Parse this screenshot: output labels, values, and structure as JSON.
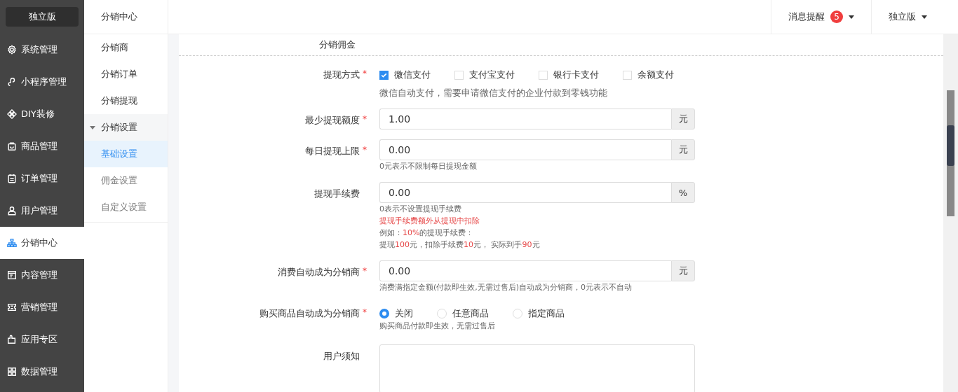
{
  "sidebar": {
    "brand": "独立版",
    "items": [
      {
        "label": "系统管理",
        "selected": false
      },
      {
        "label": "小程序管理",
        "selected": false
      },
      {
        "label": "DIY装修",
        "selected": false
      },
      {
        "label": "商品管理",
        "selected": false
      },
      {
        "label": "订单管理",
        "selected": false
      },
      {
        "label": "用户管理",
        "selected": false
      },
      {
        "label": "分销中心",
        "selected": true
      },
      {
        "label": "内容管理",
        "selected": false
      },
      {
        "label": "营销管理",
        "selected": false
      },
      {
        "label": "应用专区",
        "selected": false
      },
      {
        "label": "数据管理",
        "selected": false
      }
    ]
  },
  "subnav": {
    "title": "分销中心",
    "items": [
      {
        "label": "分销商",
        "selected": false
      },
      {
        "label": "分销订单",
        "selected": false
      },
      {
        "label": "分销提现",
        "selected": false
      },
      {
        "label": "分销设置",
        "selected": false,
        "expanded": true,
        "children": [
          {
            "label": "基础设置",
            "selected": true
          },
          {
            "label": "佣金设置",
            "selected": false
          },
          {
            "label": "自定义设置",
            "selected": false
          }
        ]
      }
    ]
  },
  "topbar": {
    "notice": "消息提醒",
    "notice_count": "5",
    "edition": "独立版"
  },
  "form": {
    "section": "分销佣金",
    "fields": [
      {
        "kind": "checkboxes",
        "label": "提现方式",
        "required_mark": "*",
        "options": [
          {
            "label": "微信支付",
            "checked": true
          },
          {
            "label": "支付宝支付",
            "checked": false
          },
          {
            "label": "银行卡支付",
            "checked": false
          },
          {
            "label": "余额支付",
            "checked": false
          }
        ],
        "notes": [
          [
            {
              "text": "微信自动支付，需要申请微信支付的企业付款到零钱功能",
              "highlight": false
            }
          ]
        ]
      },
      {
        "kind": "input",
        "label": "最少提现额度",
        "required_mark": "*",
        "value": "1.00",
        "unit": "元"
      },
      {
        "kind": "input",
        "label": "每日提现上限",
        "required_mark": "*",
        "value": "0.00",
        "unit": "元",
        "notes": [
          [
            {
              "text": "0元表示不限制每日提现金额",
              "highlight": false
            }
          ]
        ]
      },
      {
        "kind": "input",
        "label": "提现手续费",
        "value": "0.00",
        "unit": "%",
        "notes": [
          [
            {
              "text": "0表示不设置提现手续费",
              "highlight": false
            }
          ],
          [
            {
              "text": "提现手续费额外从提现中扣除",
              "highlight": true
            }
          ],
          [
            {
              "text": "例如：",
              "highlight": false
            },
            {
              "text": "10%",
              "highlight": true
            },
            {
              "text": "的提现手续费：",
              "highlight": false
            }
          ],
          [
            {
              "text": "提现",
              "highlight": false
            },
            {
              "text": "100",
              "highlight": true
            },
            {
              "text": "元，扣除手续费",
              "highlight": false
            },
            {
              "text": "10",
              "highlight": true
            },
            {
              "text": "元， 实际到手",
              "highlight": false
            },
            {
              "text": "90",
              "highlight": true
            },
            {
              "text": "元",
              "highlight": false
            }
          ]
        ]
      },
      {
        "kind": "input",
        "label": "消费自动成为分销商",
        "required_mark": "*",
        "value": "0.00",
        "unit": "元",
        "notes": [
          [
            {
              "text": "消费满指定金额(付款即生效,无需过售后)自动成为分销商，0元表示不自动",
              "highlight": false
            }
          ]
        ]
      },
      {
        "kind": "radios",
        "label": "购买商品自动成为分销商",
        "required_mark": "*",
        "options": [
          {
            "label": "关闭",
            "selected": true
          },
          {
            "label": "任意商品",
            "selected": false
          },
          {
            "label": "指定商品",
            "selected": false
          }
        ],
        "notes": [
          [
            {
              "text": "购买商品付款即生效，无需过售后",
              "highlight": false
            }
          ]
        ]
      },
      {
        "kind": "textarea",
        "label": "用户须知"
      }
    ]
  }
}
